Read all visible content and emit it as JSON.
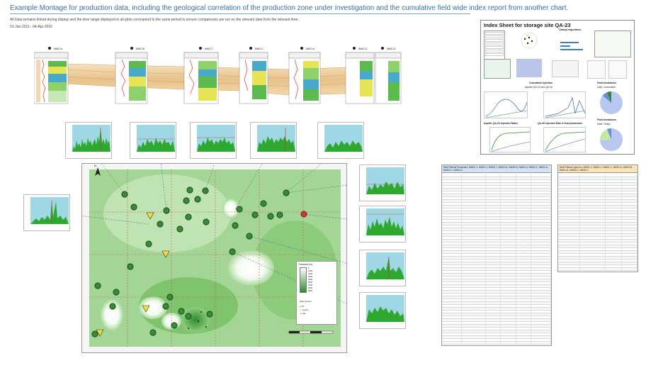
{
  "header": {
    "title": "Example Montage for production data, including the geological correlation of the production zone under investigation and the cumulative field wide index report from another chart.",
    "subtitle": "All Data remains linked during display and the time range displayed in all plots correspond to the same period to ensure comparisons are run on the relevant data from the relevant time.",
    "date_range": "01-Jan-2011 - 04-Apr-2016"
  },
  "correlation": {
    "wells": [
      "NW02-A",
      "NW02-B",
      "NW02-1",
      "NW01-1",
      "NW01-A",
      "NW02-A",
      "NW02-A"
    ]
  },
  "map": {
    "north": "N",
    "legend_title": "Thickness (m)",
    "legend_values": [
      "0",
      "1200",
      "2400",
      "3600",
      "4800",
      "6000",
      "7200",
      "8400",
      "9600"
    ],
    "legend_well_title": "Well Symbol",
    "legend_well_items": [
      "Oil",
      "Injector",
      "Gas"
    ],
    "colors": {
      "low": "#ffffff",
      "high": "#2e8b2e",
      "grid": "#d9534f",
      "leader": "#3355aa"
    }
  },
  "index_sheet": {
    "title": "Index Sheet for storage site QA-23",
    "casing": "Casing Inspections",
    "cum_injection_title": "Cumulative Injection",
    "cum_injection_sub": "Aquifer QA-23 and QA-26",
    "fluid_breakdown_1_title": "Fluid breakdown",
    "fluid_breakdown_1_sub": "Date: Cumulative",
    "fluid_breakdown_2_title": "Fluid breakdown",
    "fluid_breakdown_2_sub": "Date: Today",
    "injection_rates": "Aquifer QA-23 Injection Rates",
    "injection_rates_2": "QA-26 Injection Rate & fluid production"
  },
  "tables": {
    "producers_header": "Well Filtered Producers: NW01-1, NW01-2, NW02-1, NW02-A, NW02-B, NW01-A, NW02-1, NW02-A, NW02-C, NW02-C",
    "injectors_header": "Well Filtered Injectors: NW01-1, NW01-2, NW02-1, NW02-A, NW02-B, NW01-A, NW02-2, NW02-C"
  }
}
